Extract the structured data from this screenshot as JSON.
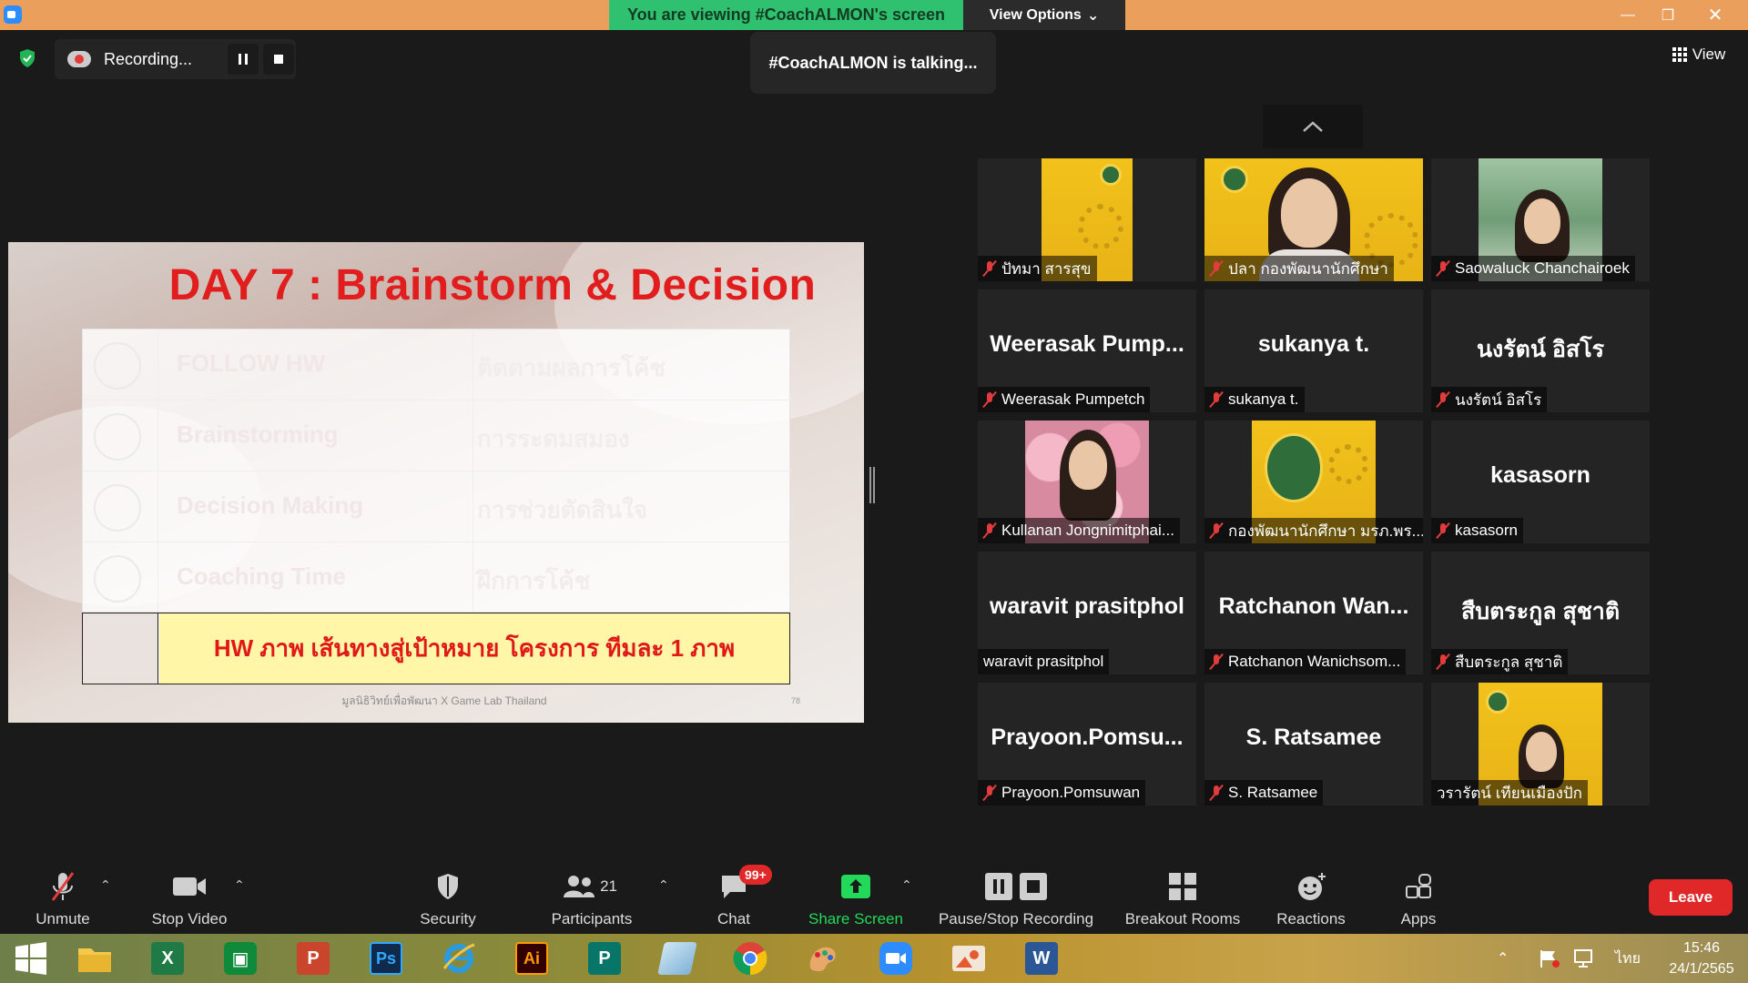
{
  "top_bar": {
    "viewing_text": "You are viewing #CoachALMON's screen",
    "view_options_label": "View Options",
    "colors": {
      "bar": "#ea9f5d",
      "banner": "#2fc16f"
    }
  },
  "recording": {
    "label": "Recording..."
  },
  "talking_indicator": "#CoachALMON is talking...",
  "view_button_label": "View",
  "slide": {
    "title": "DAY 7 : Brainstorm & Decision",
    "rows": [
      {
        "en": "FOLLOW HW",
        "th": "ติดตามผลการโค้ช"
      },
      {
        "en": "Brainstorming",
        "th": "การระดมสมอง"
      },
      {
        "en": "Decision Making",
        "th": "การช่วยตัดสินใจ"
      },
      {
        "en": "Coaching Time",
        "th": "ฝึกการโค้ช"
      }
    ],
    "homework": "HW ภาพ เส้นทางสู่เป้าหมาย โครงการ ทีมละ 1 ภาพ",
    "footer": "มูลนิธิวิทย์เพื่อพัฒนา X Game Lab Thailand",
    "page_no": "78",
    "colors": {
      "title": "#e11d1d",
      "hw_bg": "#fff6a8"
    }
  },
  "participants": [
    {
      "name": "ปัทมา สารสุข",
      "muted": true,
      "display": "poster"
    },
    {
      "name": "ปลา กองพัฒนานักศึกษา",
      "muted": true,
      "display": "poster-person"
    },
    {
      "name": "Saowaluck Chanchairoek",
      "muted": true,
      "display": "photo"
    },
    {
      "name": "Weerasak Pumpetch",
      "big_name": "Weerasak Pump...",
      "muted": true
    },
    {
      "name": "sukanya t.",
      "big_name": "sukanya t.",
      "muted": true
    },
    {
      "name": "นงรัตน์ อิสโร",
      "big_name": "นงรัตน์ อิสโร",
      "muted": true
    },
    {
      "name": "Kullanan Jongnimitphai...",
      "muted": true,
      "display": "flowers"
    },
    {
      "name": "กองพัฒนานักศึกษา มรภ.พร...",
      "muted": true,
      "display": "poster-seal"
    },
    {
      "name": "kasasorn",
      "big_name": "kasasorn",
      "muted": true
    },
    {
      "name": "waravit prasitphol",
      "big_name": "waravit prasitphol",
      "muted": false
    },
    {
      "name": "Ratchanon Wanichsom...",
      "big_name": "Ratchanon  Wan...",
      "muted": true
    },
    {
      "name": "สืบตระกูล สุชาติ",
      "big_name": "สืบตระกูล สุชาติ",
      "muted": true
    },
    {
      "name": "Prayoon.Pomsuwan",
      "big_name": "Prayoon.Pomsu...",
      "muted": true
    },
    {
      "name": "S. Ratsamee",
      "big_name": "S. Ratsamee",
      "muted": true
    },
    {
      "name": "วรารัตน์ เทียนเมืองปัก",
      "muted": false,
      "display": "poster-person"
    }
  ],
  "toolbar": {
    "unmute": "Unmute",
    "stop_video": "Stop Video",
    "security": "Security",
    "participants_label": "Participants",
    "participants_count": "21",
    "chat": "Chat",
    "chat_badge": "99+",
    "share_screen": "Share Screen",
    "pause_stop_recording": "Pause/Stop Recording",
    "breakout_rooms": "Breakout Rooms",
    "reactions": "Reactions",
    "apps": "Apps",
    "leave": "Leave",
    "colors": {
      "share_green": "#23d959",
      "leave_red": "#e02828"
    }
  },
  "taskbar": {
    "apps": [
      "windows-start",
      "file-explorer",
      "excel",
      "store",
      "powerpoint",
      "photoshop",
      "internet-explorer",
      "illustrator",
      "publisher",
      "clipboard-tool",
      "chrome",
      "paint",
      "zoom",
      "photo-viewer",
      "word"
    ],
    "excel_letter": "X",
    "powerpoint_letter": "P",
    "photoshop_letters": "Ps",
    "illustrator_letters": "Ai",
    "publisher_letter": "P",
    "word_letter": "W",
    "language": "ไทย",
    "time": "15:46",
    "date": "24/1/2565"
  }
}
